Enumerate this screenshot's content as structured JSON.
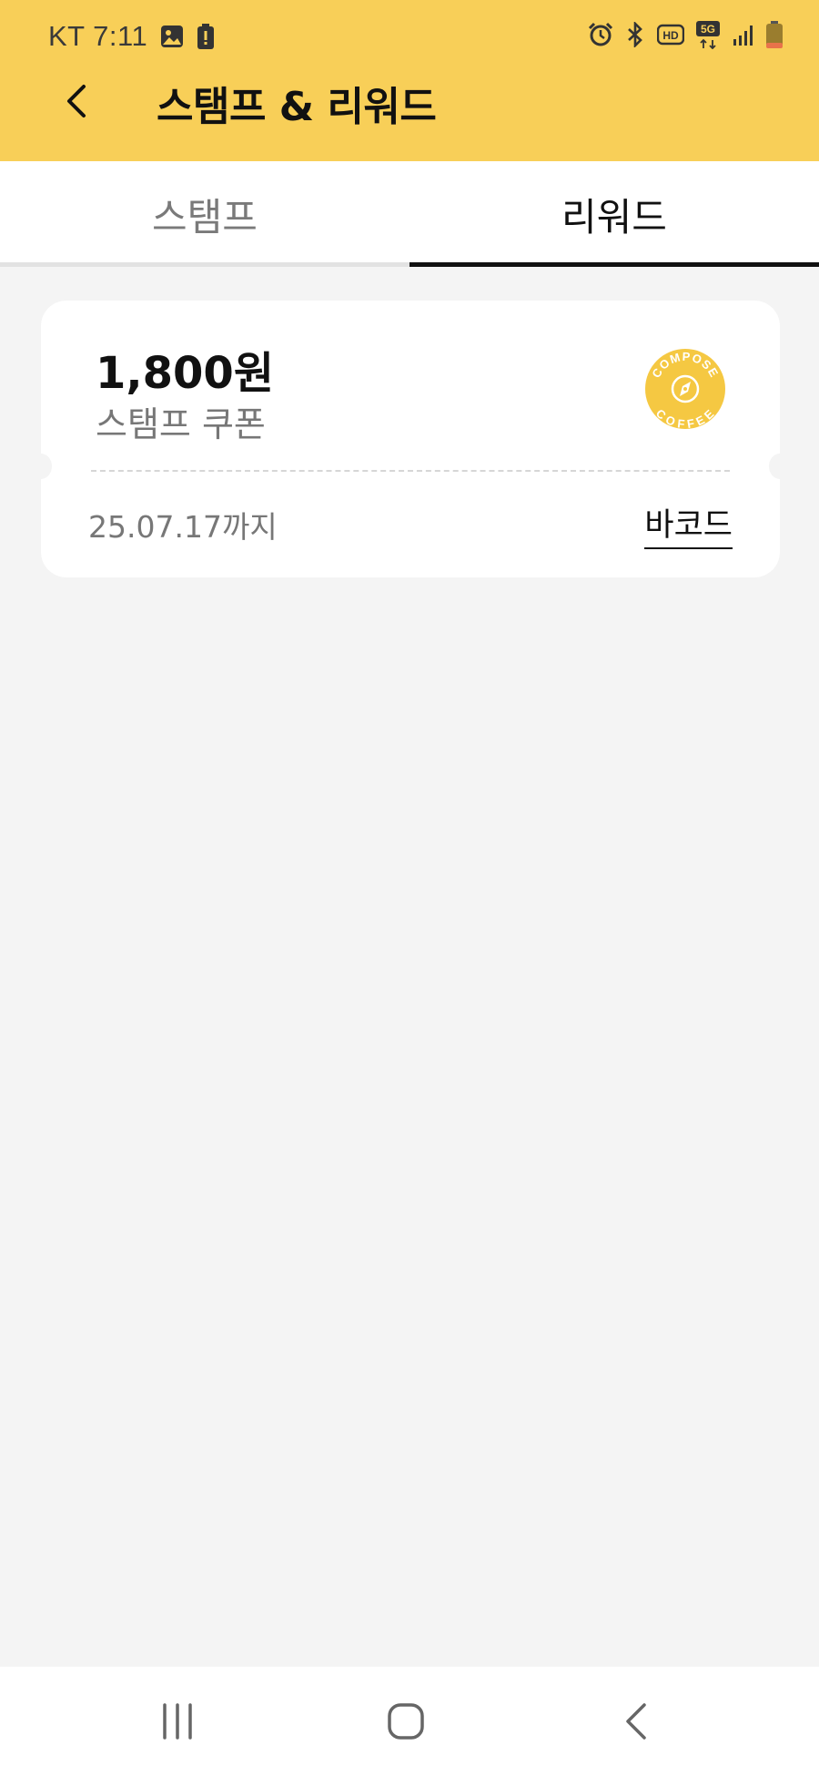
{
  "status_bar": {
    "carrier_time": "KT 7:11",
    "network": "5G"
  },
  "header": {
    "title": "스탬프 & 리워드",
    "background": "#f8cf58"
  },
  "tabs": [
    {
      "label": "스탬프",
      "active": false
    },
    {
      "label": "리워드",
      "active": true
    }
  ],
  "coupon": {
    "amount": "1,800원",
    "type": "스탬프 쿠폰",
    "expiry": "25.07.17까지",
    "barcode_label": "바코드",
    "brand_logo_text": [
      "COMPOSE",
      "COFFEE"
    ]
  },
  "nav": {
    "icons": [
      "recent-apps-icon",
      "home-icon",
      "back-icon"
    ]
  }
}
